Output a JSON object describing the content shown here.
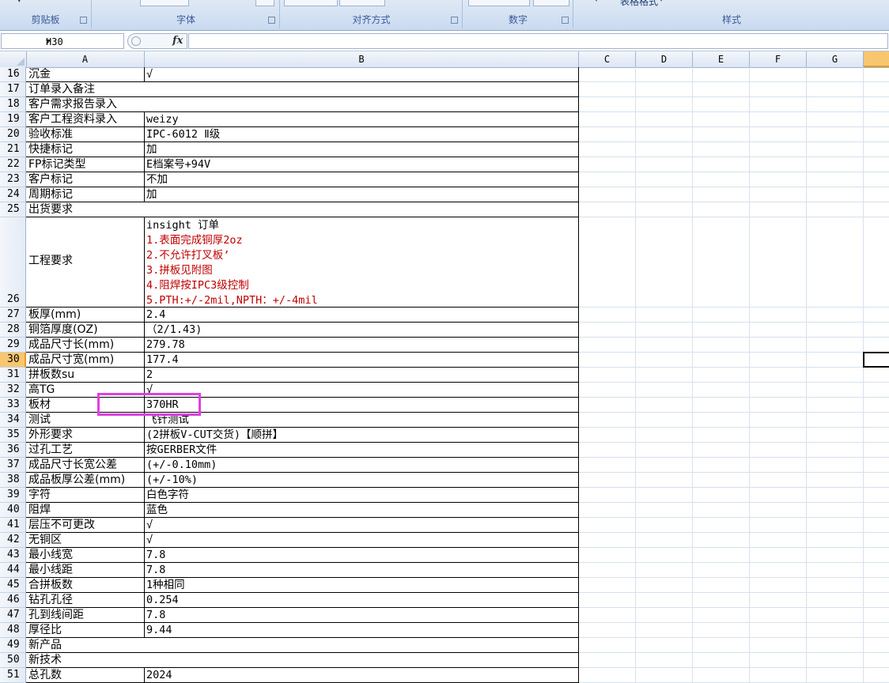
{
  "ribbon": {
    "groups": [
      {
        "label": "剪贴板"
      },
      {
        "label": "字体"
      },
      {
        "label": "对齐方式"
      },
      {
        "label": "数字"
      },
      {
        "label": "样式",
        "partial_text": "表格格式"
      }
    ]
  },
  "formula_bar": {
    "name_box": "H30",
    "fx_label": "fx",
    "formula": ""
  },
  "columns": [
    "A",
    "B",
    "C",
    "D",
    "E",
    "F",
    "G"
  ],
  "selected_column": "H",
  "selected_row": "30",
  "rows": [
    {
      "num": "16",
      "a": "沉金",
      "b": "√"
    },
    {
      "num": "17",
      "a": "订单录入备注",
      "b": ""
    },
    {
      "num": "18",
      "a": "客户需求报告录入",
      "b": ""
    },
    {
      "num": "19",
      "a": "客户工程资料录入",
      "b": "weizy"
    },
    {
      "num": "20",
      "a": "验收标准",
      "b": "IPC-6012 Ⅱ级"
    },
    {
      "num": "21",
      "a": "快捷标记",
      "b": "加"
    },
    {
      "num": "22",
      "a": "FP标记类型",
      "b": "E档案号+94V"
    },
    {
      "num": "23",
      "a": "客户标记",
      "b": "不加"
    },
    {
      "num": "24",
      "a": "周期标记",
      "b": "加"
    },
    {
      "num": "25",
      "a": "出货要求",
      "b": ""
    },
    {
      "num": "26",
      "a": "工程要求",
      "b_lines": [
        "insight 订单",
        "1.表面完成铜厚2oz",
        "2.不允许打叉板’",
        "3.拼板见附图",
        "4.阻焊按IPC3级控制",
        "5.PTH:+/-2mil,NPTH：+/-4mil"
      ]
    },
    {
      "num": "27",
      "a": "板厚(mm)",
      "b": "2.4"
    },
    {
      "num": "28",
      "a": "铜箔厚度(OZ)",
      "b": "（2/1.43)"
    },
    {
      "num": "29",
      "a": "成品尺寸长(mm)",
      "b": "279.78"
    },
    {
      "num": "30",
      "a": "成品尺寸宽(mm)",
      "b": "177.4"
    },
    {
      "num": "31",
      "a": "拼板数su",
      "b": "2"
    },
    {
      "num": "32",
      "a": "高TG",
      "b": "√"
    },
    {
      "num": "33",
      "a": "板材",
      "b": "370HR"
    },
    {
      "num": "34",
      "a": "测试",
      "b": "飞针测试"
    },
    {
      "num": "35",
      "a": "外形要求",
      "b": "(2拼板V-CUT交货)【顺拼】"
    },
    {
      "num": "36",
      "a": "过孔工艺",
      "b": "按GERBER文件"
    },
    {
      "num": "37",
      "a": "成品尺寸长宽公差",
      "b": "(+/-0.10mm)"
    },
    {
      "num": "38",
      "a": "成品板厚公差(mm)",
      "b": "(+/-10%)"
    },
    {
      "num": "39",
      "a": "字符",
      "b": "白色字符"
    },
    {
      "num": "40",
      "a": "阻焊",
      "b": "蓝色"
    },
    {
      "num": "41",
      "a": "层压不可更改",
      "b": "√"
    },
    {
      "num": "42",
      "a": "无铜区",
      "b": "√"
    },
    {
      "num": "43",
      "a": "最小线宽",
      "b": "7.8"
    },
    {
      "num": "44",
      "a": "最小线距",
      "b": "7.8"
    },
    {
      "num": "45",
      "a": "合拼板数",
      "b": "1种相同"
    },
    {
      "num": "46",
      "a": "钻孔孔径",
      "b": "0.254"
    },
    {
      "num": "47",
      "a": "孔到线间距",
      "b": "7.8"
    },
    {
      "num": "48",
      "a": "厚径比",
      "b": "9.44"
    },
    {
      "num": "49",
      "a": "新产品",
      "b": ""
    },
    {
      "num": "50",
      "a": "新技术",
      "b": ""
    },
    {
      "num": "51",
      "a": "总孔数",
      "b": "2024"
    }
  ],
  "colors": {
    "highlight_box": "#e040e0",
    "red_text": "#c00000",
    "selected_header": "#f8c66e"
  }
}
